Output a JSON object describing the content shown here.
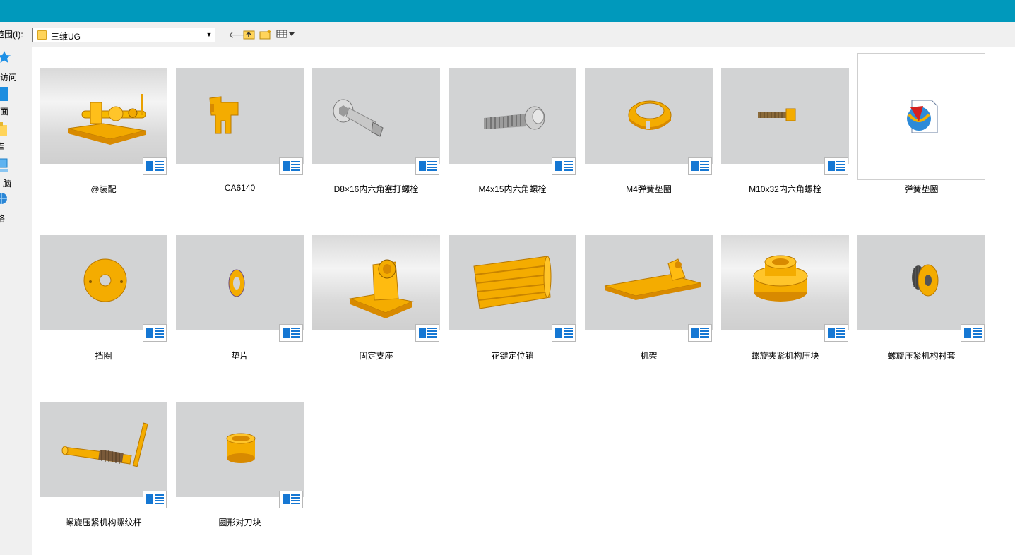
{
  "window": {
    "title_bar_color": "#0099bc"
  },
  "toolbar": {
    "look_in_label": "范围(I):",
    "location_value": "三维UG",
    "icons": [
      "back-arrow-icon",
      "up-folder-icon",
      "new-folder-icon",
      "view-menu-icon"
    ]
  },
  "sidebar": {
    "items": [
      {
        "label": "访问",
        "icon": "star-icon"
      },
      {
        "label": "面",
        "icon": "desktop-icon"
      },
      {
        "label": "库",
        "icon": "library-icon"
      },
      {
        "label": "脑",
        "icon": "computer-icon"
      },
      {
        "label": "络",
        "icon": "network-icon"
      }
    ]
  },
  "files": [
    {
      "name": "@装配",
      "thumb": "assembly"
    },
    {
      "name": "CA6140",
      "thumb": "ca6140"
    },
    {
      "name": "D8×16内六角塞打螺栓",
      "thumb": "shoulder-bolt"
    },
    {
      "name": "M4x15内六角螺栓",
      "thumb": "hex-bolt"
    },
    {
      "name": "M4弹簧垫圈",
      "thumb": "spring-washer"
    },
    {
      "name": "M10x32内六角螺栓",
      "thumb": "small-bolt"
    },
    {
      "name": "弹簧垫圈",
      "thumb": "nx-icon"
    },
    {
      "name": "挡圈",
      "thumb": "retaining-ring"
    },
    {
      "name": "垫片",
      "thumb": "gasket"
    },
    {
      "name": "固定支座",
      "thumb": "fixed-support"
    },
    {
      "name": "花键定位销",
      "thumb": "spline-pin"
    },
    {
      "name": "机架",
      "thumb": "frame"
    },
    {
      "name": "螺旋夹紧机构压块",
      "thumb": "press-block"
    },
    {
      "name": "螺旋压紧机构衬套",
      "thumb": "bushing"
    },
    {
      "name": "螺旋压紧机构螺纹杆",
      "thumb": "threaded-rod"
    },
    {
      "name": "圆形对刀块",
      "thumb": "tool-block"
    }
  ],
  "colors": {
    "part_orange": "#f2a900",
    "badge_blue": "#1577d3"
  }
}
